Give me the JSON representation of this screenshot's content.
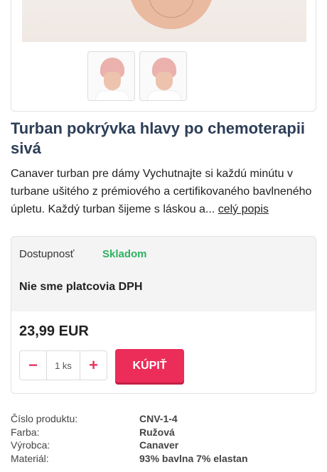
{
  "product": {
    "title": "Turban pokrývka hlavy po chemoterapii sivá",
    "description": "Canaver turban pre dámy Vychutnajte si každú minútu v turbane ušitého z prémiového a certifikovaného bavlneného úpletu. Každý turban šijeme s láskou a...",
    "more_link": "celý popis"
  },
  "gallery": {
    "thumbnails": [
      "product-thumb-front",
      "product-thumb-side"
    ]
  },
  "buy": {
    "availability_label": "Dostupnosť",
    "availability_value": "Skladom",
    "vat_note": "Nie sme platcovia DPH",
    "price": "23,99 EUR",
    "qty_minus": "−",
    "qty_value": "1 ks",
    "qty_plus": "+",
    "buy_label": "KÚPIŤ"
  },
  "params": [
    {
      "label": "Číslo produktu:",
      "value": "CNV-1-4"
    },
    {
      "label": "Farba:",
      "value": "Ružová"
    },
    {
      "label": "Výrobca:",
      "value": "Canaver"
    },
    {
      "label": "Materiál:",
      "value": "93% bavlna 7% elastan"
    }
  ],
  "colors": {
    "title": "#2d3e57",
    "accent": "#ec2c59",
    "in_stock": "#2fb260"
  }
}
